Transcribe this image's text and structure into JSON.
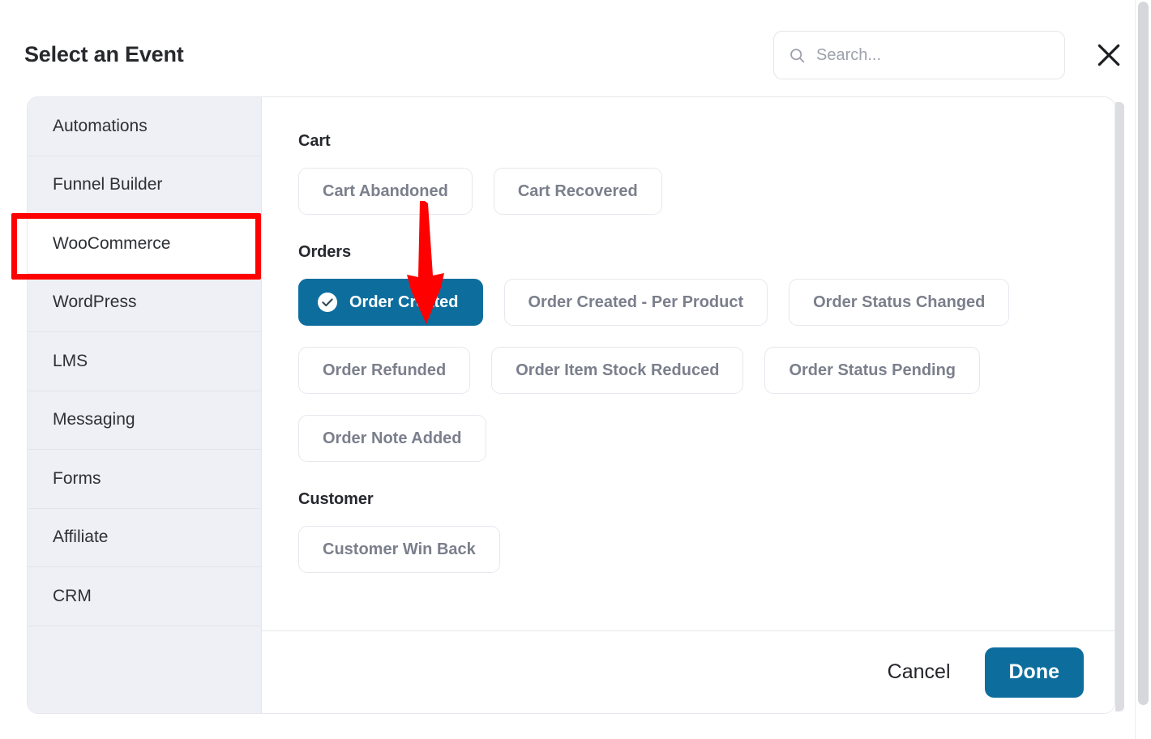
{
  "header": {
    "title": "Select an Event",
    "search": {
      "placeholder": "Search...",
      "value": "",
      "icon": "search-icon"
    },
    "close_icon": "close-icon"
  },
  "sidebar": {
    "items": [
      {
        "label": "Automations",
        "active": false
      },
      {
        "label": "Funnel Builder",
        "active": false
      },
      {
        "label": "WooCommerce",
        "active": true
      },
      {
        "label": "WordPress",
        "active": false
      },
      {
        "label": "LMS",
        "active": false
      },
      {
        "label": "Messaging",
        "active": false
      },
      {
        "label": "Forms",
        "active": false
      },
      {
        "label": "Affiliate",
        "active": false
      },
      {
        "label": "CRM",
        "active": false
      }
    ]
  },
  "main": {
    "groups": [
      {
        "title": "Cart",
        "events": [
          {
            "label": "Cart Abandoned",
            "selected": false
          },
          {
            "label": "Cart Recovered",
            "selected": false
          }
        ]
      },
      {
        "title": "Orders",
        "events": [
          {
            "label": "Order Created",
            "selected": true,
            "icon": "check-circle-icon"
          },
          {
            "label": "Order Created - Per Product",
            "selected": false
          },
          {
            "label": "Order Status Changed",
            "selected": false
          },
          {
            "label": "Order Refunded",
            "selected": false
          },
          {
            "label": "Order Item Stock Reduced",
            "selected": false
          },
          {
            "label": "Order Status Pending",
            "selected": false
          },
          {
            "label": "Order Note Added",
            "selected": false
          }
        ]
      },
      {
        "title": "Customer",
        "events": [
          {
            "label": "Customer Win Back",
            "selected": false
          }
        ]
      }
    ]
  },
  "footer": {
    "cancel_label": "Cancel",
    "done_label": "Done"
  },
  "annotations": {
    "highlight_target": "WooCommerce",
    "arrow_target": "Order Created",
    "color": "#fe0000"
  },
  "colors": {
    "accent": "#0d6e9e",
    "sidebar_bg": "#eef0f5",
    "chip_text": "#7b7f8c",
    "annotation_red": "#fe0000"
  }
}
